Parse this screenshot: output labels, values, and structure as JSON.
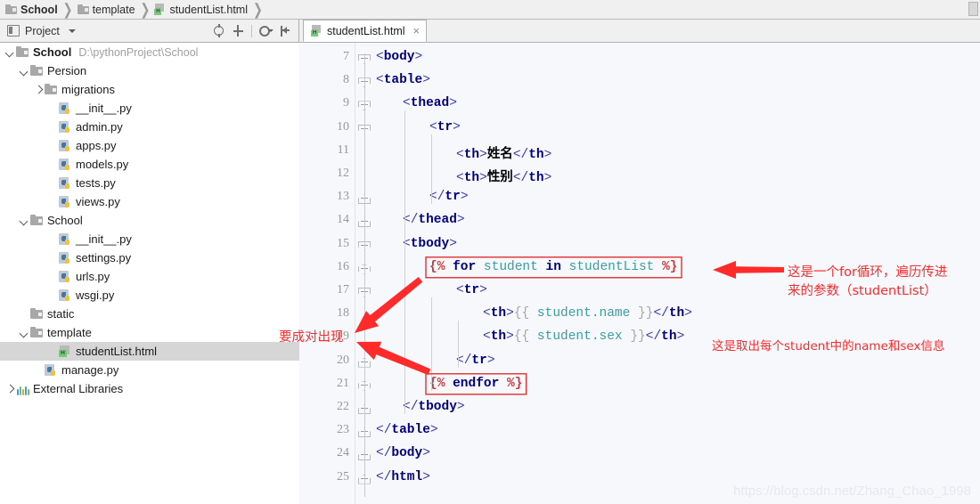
{
  "breadcrumb": {
    "items": [
      {
        "label": "School",
        "icon": "folder-icon",
        "bold": true
      },
      {
        "label": "template",
        "icon": "folder-icon",
        "bold": false
      },
      {
        "label": "studentList.html",
        "icon": "html-file-icon",
        "bold": false
      }
    ],
    "separator": "❯"
  },
  "project_panel": {
    "title": "Project",
    "dropdown_caret": "▾",
    "actions": [
      {
        "name": "locate-icon",
        "tooltip": "Select Opened File"
      },
      {
        "name": "collapse-all-icon",
        "tooltip": "Collapse All"
      },
      {
        "name": "gear-icon",
        "tooltip": "Settings"
      },
      {
        "name": "hide-icon",
        "tooltip": "Hide"
      }
    ]
  },
  "tree": [
    {
      "label": "School",
      "path": "D:\\pythonProject\\School",
      "icon": "folder-icon",
      "indent": 0,
      "arrow": "down",
      "bold": true,
      "selected": false
    },
    {
      "label": "Persion",
      "path": "",
      "icon": "folder-icon",
      "indent": 1,
      "arrow": "down",
      "bold": false,
      "selected": false
    },
    {
      "label": "migrations",
      "path": "",
      "icon": "folder-icon",
      "indent": 2,
      "arrow": "right",
      "bold": false,
      "selected": false
    },
    {
      "label": "__init__.py",
      "path": "",
      "icon": "python-file-icon",
      "indent": 3,
      "arrow": "",
      "bold": false,
      "selected": false
    },
    {
      "label": "admin.py",
      "path": "",
      "icon": "python-file-icon",
      "indent": 3,
      "arrow": "",
      "bold": false,
      "selected": false
    },
    {
      "label": "apps.py",
      "path": "",
      "icon": "python-file-icon",
      "indent": 3,
      "arrow": "",
      "bold": false,
      "selected": false
    },
    {
      "label": "models.py",
      "path": "",
      "icon": "python-file-icon",
      "indent": 3,
      "arrow": "",
      "bold": false,
      "selected": false
    },
    {
      "label": "tests.py",
      "path": "",
      "icon": "python-file-icon",
      "indent": 3,
      "arrow": "",
      "bold": false,
      "selected": false
    },
    {
      "label": "views.py",
      "path": "",
      "icon": "python-file-icon",
      "indent": 3,
      "arrow": "",
      "bold": false,
      "selected": false
    },
    {
      "label": "School",
      "path": "",
      "icon": "folder-icon",
      "indent": 1,
      "arrow": "down",
      "bold": false,
      "selected": false
    },
    {
      "label": "__init__.py",
      "path": "",
      "icon": "python-file-icon",
      "indent": 3,
      "arrow": "",
      "bold": false,
      "selected": false
    },
    {
      "label": "settings.py",
      "path": "",
      "icon": "python-file-icon",
      "indent": 3,
      "arrow": "",
      "bold": false,
      "selected": false
    },
    {
      "label": "urls.py",
      "path": "",
      "icon": "python-file-icon",
      "indent": 3,
      "arrow": "",
      "bold": false,
      "selected": false
    },
    {
      "label": "wsgi.py",
      "path": "",
      "icon": "python-file-icon",
      "indent": 3,
      "arrow": "",
      "bold": false,
      "selected": false
    },
    {
      "label": "static",
      "path": "",
      "icon": "folder-icon",
      "indent": 1,
      "arrow": "",
      "bold": false,
      "selected": false
    },
    {
      "label": "template",
      "path": "",
      "icon": "folder-icon",
      "indent": 1,
      "arrow": "down",
      "bold": false,
      "selected": false
    },
    {
      "label": "studentList.html",
      "path": "",
      "icon": "html-file-icon",
      "indent": 3,
      "arrow": "",
      "bold": false,
      "selected": true
    },
    {
      "label": "manage.py",
      "path": "",
      "icon": "python-file-icon",
      "indent": 2,
      "arrow": "",
      "bold": false,
      "selected": false
    },
    {
      "label": "External Libraries",
      "path": "",
      "icon": "library-icon",
      "indent": 0,
      "arrow": "right",
      "bold": false,
      "selected": false
    }
  ],
  "editor": {
    "tab": {
      "label": "studentList.html",
      "icon": "html-file-icon",
      "close": "×"
    },
    "first_line_number": 7,
    "lines": [
      {
        "n": 7,
        "indent": 0,
        "text": "<body>"
      },
      {
        "n": 8,
        "indent": 0,
        "text": "<table>"
      },
      {
        "n": 9,
        "indent": 1,
        "text": "<thead>"
      },
      {
        "n": 10,
        "indent": 2,
        "text": "<tr>"
      },
      {
        "n": 11,
        "indent": 3,
        "text": "<th>姓名</th>"
      },
      {
        "n": 12,
        "indent": 3,
        "text": "<th>性别</th>"
      },
      {
        "n": 13,
        "indent": 2,
        "text": "</tr>"
      },
      {
        "n": 14,
        "indent": 1,
        "text": "</thead>"
      },
      {
        "n": 15,
        "indent": 1,
        "text": "<tbody>"
      },
      {
        "n": 16,
        "indent": 2,
        "text": "{% for student in studentList %}"
      },
      {
        "n": 17,
        "indent": 3,
        "text": "<tr>"
      },
      {
        "n": 18,
        "indent": 4,
        "text": "<th>{{ student.name }}</th>"
      },
      {
        "n": 19,
        "indent": 4,
        "text": "<th>{{ student.sex }}</th>"
      },
      {
        "n": 20,
        "indent": 3,
        "text": "</tr>"
      },
      {
        "n": 21,
        "indent": 2,
        "text": "{% endfor %}"
      },
      {
        "n": 22,
        "indent": 1,
        "text": "</tbody>"
      },
      {
        "n": 23,
        "indent": 0,
        "text": "</table>"
      },
      {
        "n": 24,
        "indent": 0,
        "text": "</body>"
      },
      {
        "n": 25,
        "indent": 0,
        "text": "</html>"
      }
    ]
  },
  "annotations": {
    "pair_note": "要成对出现",
    "for_note_line1": "这是一个for循环，遍历传进",
    "for_note_line2": "来的参数（studentList）",
    "field_note": "这是取出每个student中的name和sex信息",
    "accent_color": "#ff2a2a",
    "box_color": "#e03030"
  },
  "watermark": "https://blog.csdn.net/Zhang_Chao_1998"
}
